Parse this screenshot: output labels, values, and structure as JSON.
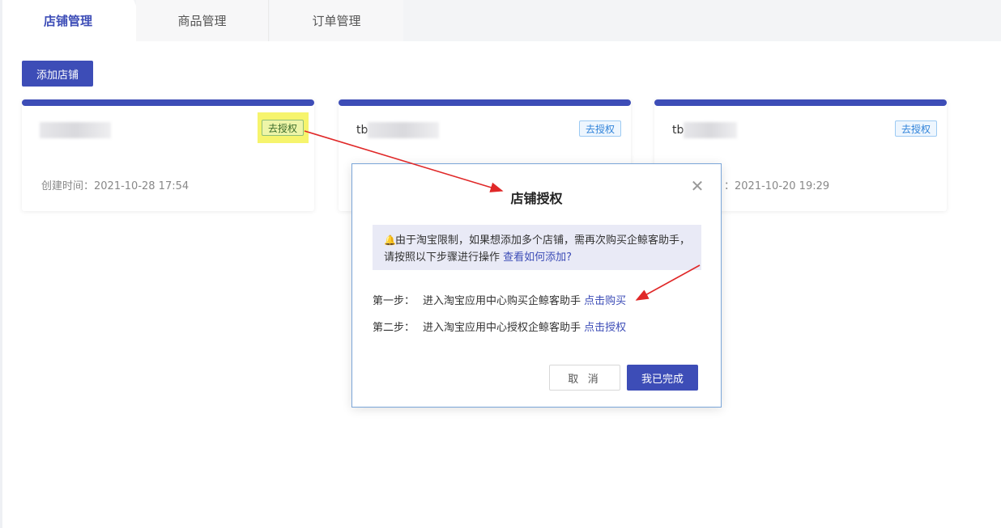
{
  "tabs": [
    {
      "label": "店铺管理",
      "active": true
    },
    {
      "label": "商品管理",
      "active": false
    },
    {
      "label": "订单管理",
      "active": false
    }
  ],
  "toolbar": {
    "add_shop_label": "添加店铺"
  },
  "cards": [
    {
      "name": "",
      "auth_label": "去授权",
      "created": "创建时间：2021-10-28 17:54"
    },
    {
      "name": "tb",
      "auth_label": "去授权",
      "created": ""
    },
    {
      "name": "tb",
      "auth_label": "去授权",
      "created": "：2021-10-20 19:29"
    }
  ],
  "modal": {
    "title": "店铺授权",
    "notice_text": "由于淘宝限制，如果想添加多个店铺，需再次购买企鲸客助手，请按照以下步骤进行操作",
    "notice_link": "查看如何添加?",
    "step1_label": "第一步：",
    "step1_text": "进入淘宝应用中心购买企鲸客助手",
    "step1_link": "点击购买",
    "step2_label": "第二步：",
    "step2_text": "进入淘宝应用中心授权企鲸客助手",
    "step2_link": "点击授权",
    "cancel_label": "取 消",
    "done_label": "我已完成"
  },
  "colors": {
    "accent": "#3d4db7",
    "tag_blue": "#2f82d9",
    "highlight": "#f6f46d",
    "arrow": "#e02828"
  }
}
